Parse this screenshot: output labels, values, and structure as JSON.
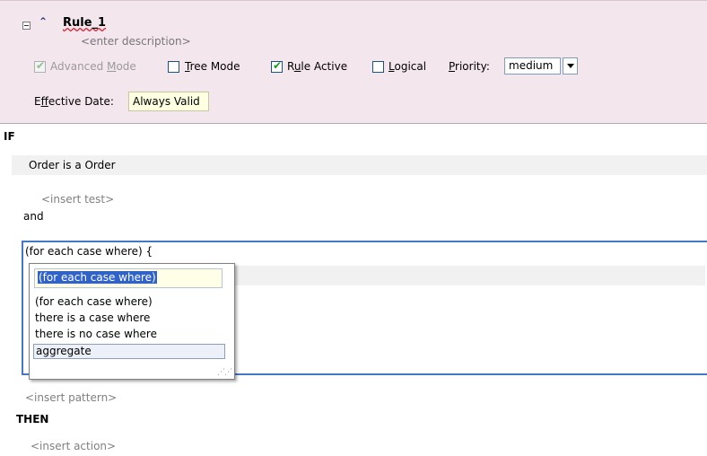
{
  "rule": {
    "name": "Rule_1",
    "description": "<enter description>",
    "options": {
      "advanced_mode": {
        "pre": "Advanced ",
        "mnemonic": "M",
        "post": "ode",
        "checked": true,
        "enabled": false
      },
      "tree_mode": {
        "pre": "",
        "mnemonic": "T",
        "post": "ree Mode",
        "checked": false
      },
      "rule_active": {
        "pre": "R",
        "mnemonic": "u",
        "post": "le Active",
        "checked": true
      },
      "logical": {
        "pre": "",
        "mnemonic": "L",
        "post": "ogical",
        "checked": false
      },
      "priority": {
        "pre": "",
        "mnemonic": "P",
        "post": "riority:",
        "value": "medium"
      }
    },
    "effective_date": {
      "pre": "E",
      "mnemonic": "f",
      "post": "fective Date:",
      "value": "Always Valid"
    }
  },
  "if_section": {
    "label": "IF",
    "fact": "Order is a Order",
    "insert_test": "<insert test>",
    "connector": "and",
    "case_header": "(for each case where)  {",
    "insert_pattern": "<insert pattern>"
  },
  "dropdown": {
    "field_value": "(for each case where)",
    "items": [
      "(for each case where)",
      "there is a case where",
      "there is no case where",
      "aggregate"
    ],
    "selected_index": 3
  },
  "then_section": {
    "label": "THEN",
    "insert_action": "<insert action>"
  },
  "colors": {
    "header_bg": "#f3e6ec",
    "frame_accent": "#4677c6",
    "highlight": "#3162c7"
  }
}
